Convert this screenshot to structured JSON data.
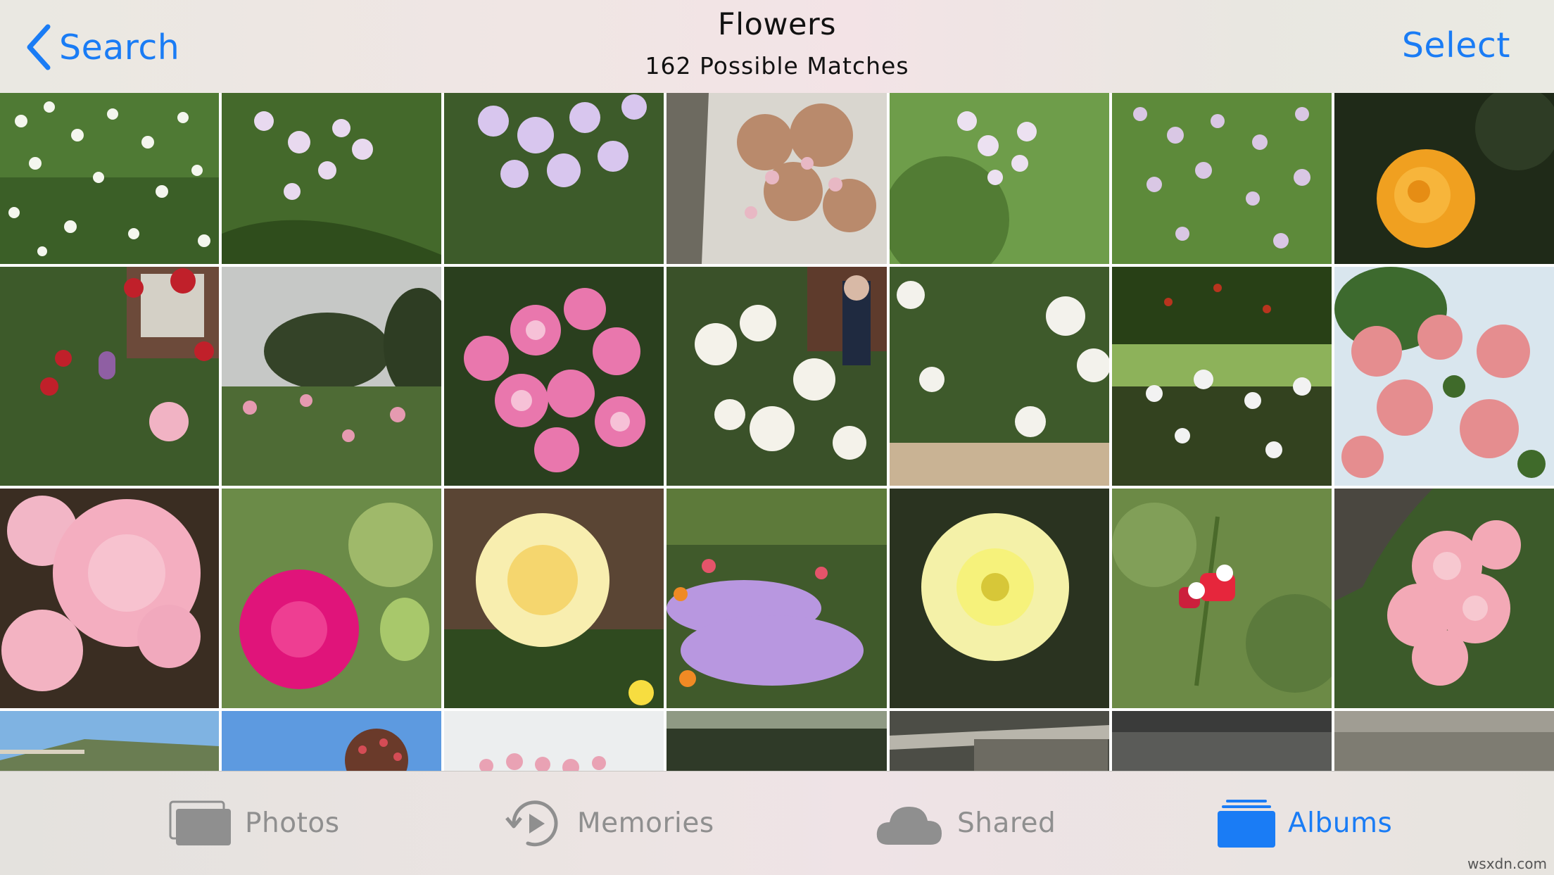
{
  "nav": {
    "back_label": "Search",
    "title": "Flowers",
    "subtitle": "162 Possible Matches",
    "select_label": "Select"
  },
  "tabs": [
    {
      "label": "Photos",
      "icon": "photos-icon",
      "active": false
    },
    {
      "label": "Memories",
      "icon": "memories-icon",
      "active": false
    },
    {
      "label": "Shared",
      "icon": "cloud-icon",
      "active": false
    },
    {
      "label": "Albums",
      "icon": "albums-icon",
      "active": true
    }
  ],
  "watermark": "wsxdn.com",
  "colors": {
    "accent": "#1a7cf5",
    "inactive_tab": "#8f8f8f"
  }
}
